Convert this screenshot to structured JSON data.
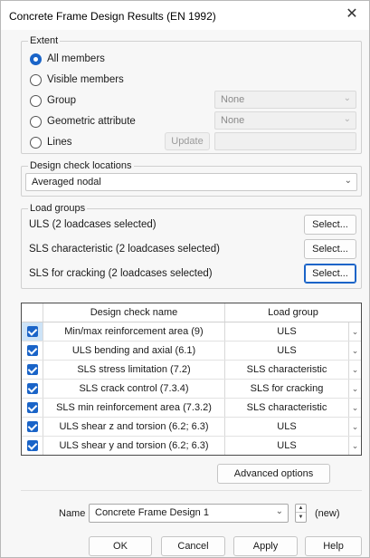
{
  "window": {
    "title": "Concrete Frame Design Results (EN 1992)"
  },
  "extent": {
    "label": "Extent",
    "options": [
      "All members",
      "Visible members",
      "Group",
      "Geometric attribute",
      "Lines"
    ],
    "selected": "All members",
    "group_value": "None",
    "geometric_value": "None",
    "update_label": "Update"
  },
  "locations": {
    "label": "Design check locations",
    "value": "Averaged nodal"
  },
  "load_groups": {
    "label": "Load groups",
    "items": [
      {
        "label": "ULS (2 loadcases selected)",
        "button": "Select..."
      },
      {
        "label": "SLS characteristic (2 loadcases selected)",
        "button": "Select..."
      },
      {
        "label": "SLS for cracking (2 loadcases selected)",
        "button": "Select..."
      }
    ]
  },
  "table": {
    "headers": [
      "Design check name",
      "Load group"
    ],
    "rows": [
      {
        "name": "Min/max reinforcement area (9)",
        "group": "ULS",
        "checked": true
      },
      {
        "name": "ULS bending and axial (6.1)",
        "group": "ULS",
        "checked": true
      },
      {
        "name": "SLS stress limitation (7.2)",
        "group": "SLS characteristic",
        "checked": true
      },
      {
        "name": "SLS crack control (7.3.4)",
        "group": "SLS for cracking",
        "checked": true
      },
      {
        "name": "SLS min reinforcement area (7.3.2)",
        "group": "SLS characteristic",
        "checked": true
      },
      {
        "name": "ULS shear z and torsion (6.2; 6.3)",
        "group": "ULS",
        "checked": true
      },
      {
        "name": "ULS shear y and torsion (6.2; 6.3)",
        "group": "ULS",
        "checked": true
      }
    ]
  },
  "advanced_label": "Advanced options",
  "name_row": {
    "label": "Name",
    "value": "Concrete Frame Design 1",
    "status": "(new)"
  },
  "footer": {
    "ok": "OK",
    "cancel": "Cancel",
    "apply": "Apply",
    "help": "Help"
  },
  "colors": {
    "accent": "#1a64c8",
    "selection": "#cde3f7"
  }
}
